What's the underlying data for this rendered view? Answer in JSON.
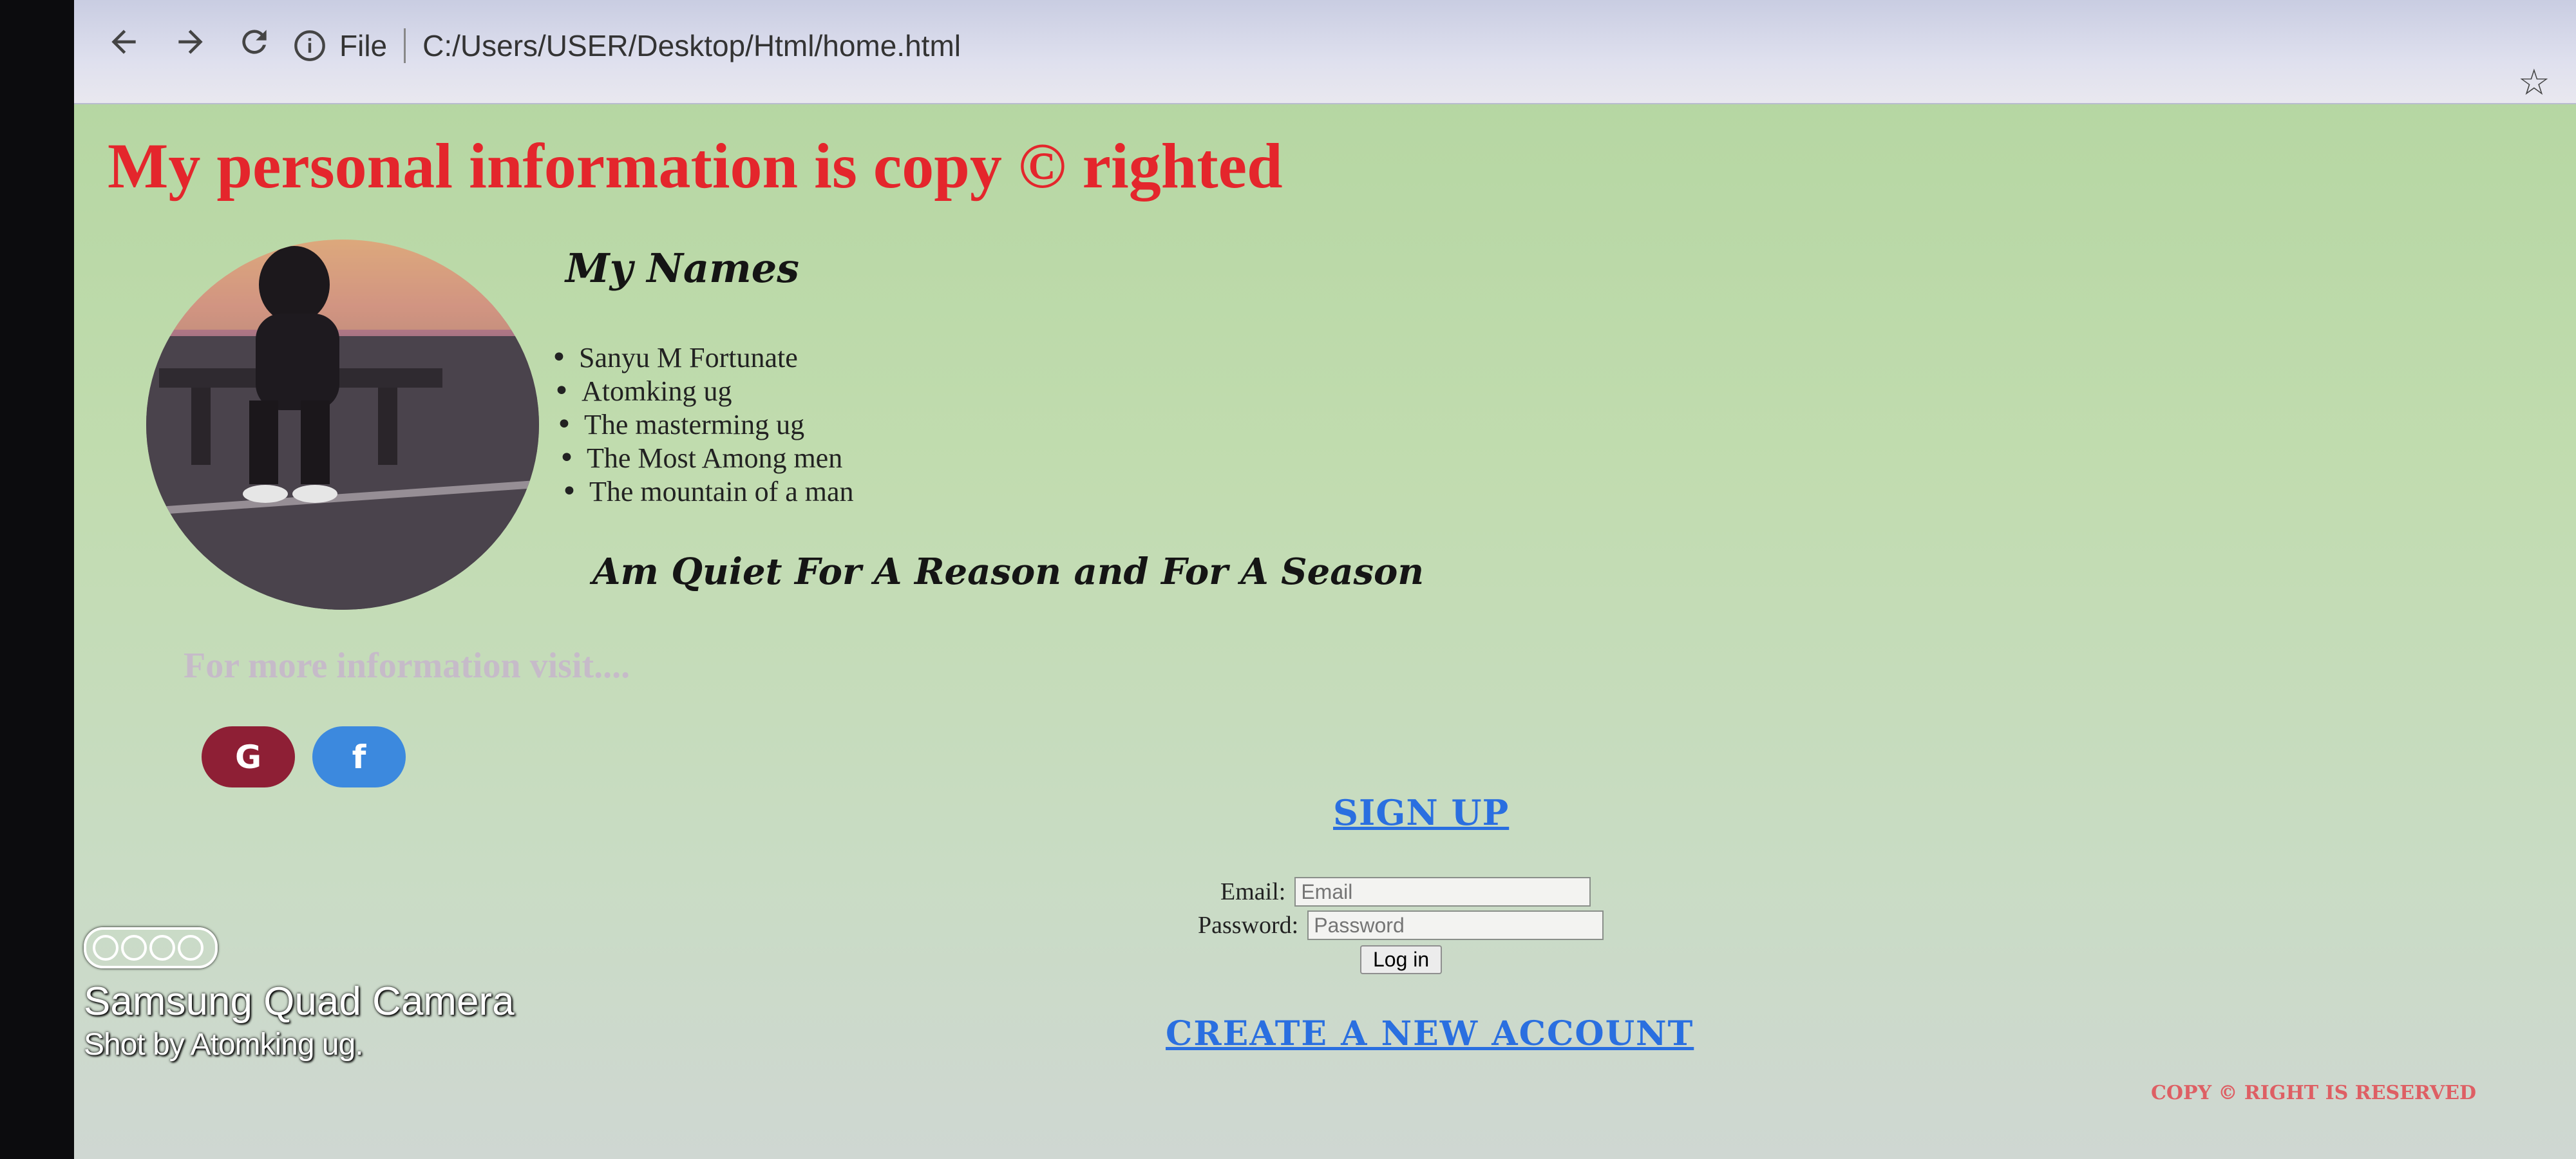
{
  "browser": {
    "scheme_label": "File",
    "address": "C:/Users/USER/Desktop/Html/home.html"
  },
  "page": {
    "title": "My personal information is copy © righted",
    "names_heading": "My Names",
    "names": [
      "Sanyu M Fortunate",
      "Atomking ug",
      "The masterming ug",
      "The Most Among men",
      "The mountain of a man"
    ],
    "quiet_heading": "Am Quiet For A Reason and For A Season",
    "more_info": "For more information visit....",
    "social": [
      {
        "icon": "google-icon",
        "glyph": "G"
      },
      {
        "icon": "facebook-icon",
        "glyph": "f"
      }
    ]
  },
  "login": {
    "signup_link": "SIGN UP",
    "email_label": "Email:",
    "email_placeholder": "Email",
    "password_label": "Password:",
    "password_placeholder": "Password",
    "login_button": "Log in",
    "create_account_link": "CREATE A NEW ACCOUNT"
  },
  "footer": {
    "copyright": "COPY © RIGHT IS RESERVED"
  },
  "watermark": {
    "camera": "Samsung Quad Camera",
    "shot_by": "Shot by Atomking ug."
  },
  "colors": {
    "title": "#e4262c",
    "link": "#2a6fe0",
    "page_bg": "#b3d59f"
  }
}
